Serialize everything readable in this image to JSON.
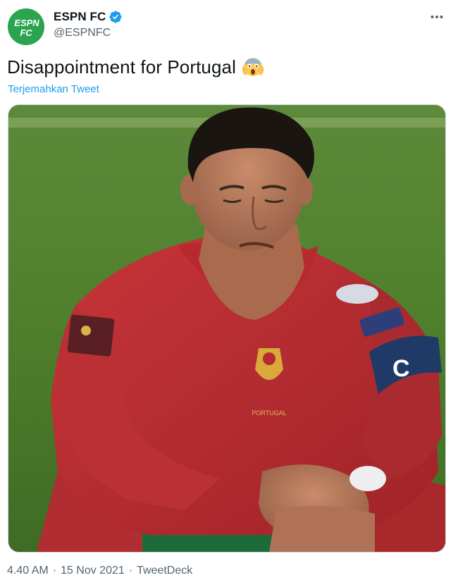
{
  "author": {
    "display_name": "ESPN FC",
    "handle": "@ESPNFC",
    "avatar_text_line1": "ESPN",
    "avatar_text_line2": "FC",
    "verified": true
  },
  "tweet": {
    "text": "Disappointment for Portugal",
    "emoji": "face-screaming-in-fear",
    "translate_label": "Terjemahkan Tweet"
  },
  "media": {
    "alt": "photo"
  },
  "meta": {
    "time": "4.40 AM",
    "separator": "·",
    "date": "15 Nov 2021",
    "source": "TweetDeck"
  },
  "colors": {
    "brand_green": "#2aa44e",
    "link_blue": "#1d9bf0",
    "secondary_text": "#536471"
  }
}
